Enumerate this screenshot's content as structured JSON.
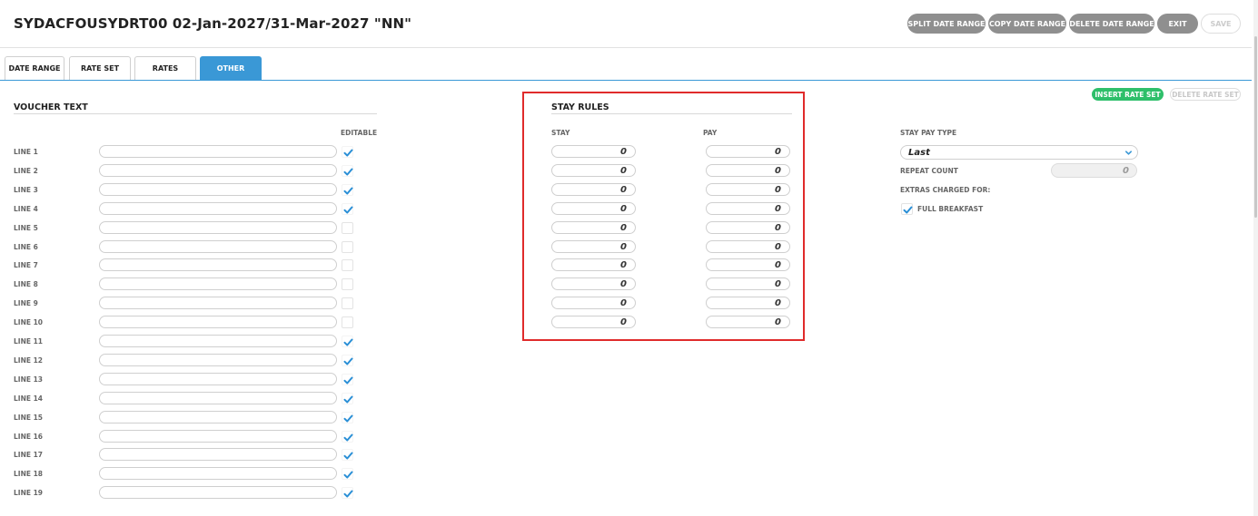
{
  "header": {
    "title": "SYDACFOUSYDRT00 02-Jan-2027/31-Mar-2027 \"NN\"",
    "buttons": {
      "split": "SPLIT DATE RANGE",
      "copy": "COPY DATE RANGE",
      "delete": "DELETE DATE RANGE",
      "exit": "EXIT",
      "save": "SAVE"
    }
  },
  "tabs": [
    {
      "label": "DATE RANGE"
    },
    {
      "label": "RATE SET"
    },
    {
      "label": "RATES"
    },
    {
      "label": "OTHER",
      "active": true
    }
  ],
  "actions": {
    "insert_rate_set": "INSERT RATE SET",
    "delete_rate_set": "DELETE RATE SET"
  },
  "voucher": {
    "title": "VOUCHER TEXT",
    "editable_header": "EDITABLE",
    "lines": [
      {
        "label": "LINE 1",
        "value": "",
        "editable": true
      },
      {
        "label": "LINE 2",
        "value": "",
        "editable": true
      },
      {
        "label": "LINE 3",
        "value": "",
        "editable": true
      },
      {
        "label": "LINE 4",
        "value": "",
        "editable": true
      },
      {
        "label": "LINE 5",
        "value": "",
        "editable": false
      },
      {
        "label": "LINE 6",
        "value": "",
        "editable": false
      },
      {
        "label": "LINE 7",
        "value": "",
        "editable": false
      },
      {
        "label": "LINE 8",
        "value": "",
        "editable": false
      },
      {
        "label": "LINE 9",
        "value": "",
        "editable": false
      },
      {
        "label": "LINE 10",
        "value": "",
        "editable": false
      },
      {
        "label": "LINE 11",
        "value": "",
        "editable": true
      },
      {
        "label": "LINE 12",
        "value": "",
        "editable": true
      },
      {
        "label": "LINE 13",
        "value": "",
        "editable": true
      },
      {
        "label": "LINE 14",
        "value": "",
        "editable": true
      },
      {
        "label": "LINE 15",
        "value": "",
        "editable": true
      },
      {
        "label": "LINE 16",
        "value": "",
        "editable": true
      },
      {
        "label": "LINE 17",
        "value": "",
        "editable": true
      },
      {
        "label": "LINE 18",
        "value": "",
        "editable": true
      },
      {
        "label": "LINE 19",
        "value": "",
        "editable": true
      }
    ]
  },
  "stay_rules": {
    "title": "STAY RULES",
    "stay_header": "STAY",
    "pay_header": "PAY",
    "rows": [
      {
        "stay": "0",
        "pay": "0"
      },
      {
        "stay": "0",
        "pay": "0"
      },
      {
        "stay": "0",
        "pay": "0"
      },
      {
        "stay": "0",
        "pay": "0"
      },
      {
        "stay": "0",
        "pay": "0"
      },
      {
        "stay": "0",
        "pay": "0"
      },
      {
        "stay": "0",
        "pay": "0"
      },
      {
        "stay": "0",
        "pay": "0"
      },
      {
        "stay": "0",
        "pay": "0"
      },
      {
        "stay": "0",
        "pay": "0"
      }
    ]
  },
  "pay_type": {
    "label": "STAY PAY TYPE",
    "selected": "Last",
    "repeat_label": "REPEAT COUNT",
    "repeat_value": "0",
    "extras_label": "EXTRAS CHARGED FOR:",
    "extras": [
      {
        "label": "FULL BREAKFAST",
        "checked": true
      }
    ]
  },
  "colors": {
    "accent": "#3a98d6",
    "green": "#2ebf6a",
    "highlight": "#e02b2b",
    "check": "#2a8fd6"
  }
}
